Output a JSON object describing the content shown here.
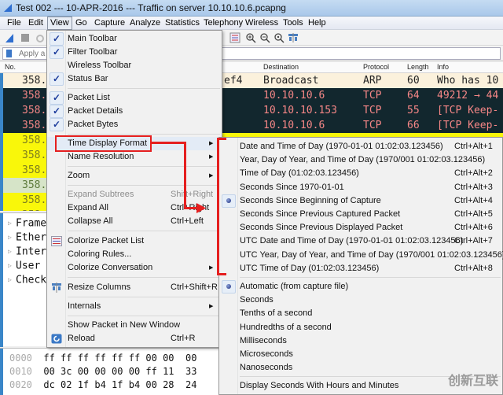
{
  "window": {
    "title": "Test 002 --- 10-APR-2016 --- Traffic on server 10.10.10.6.pcapng"
  },
  "menubar": {
    "items": [
      "File",
      "Edit",
      "View",
      "Go",
      "Capture",
      "Analyze",
      "Statistics",
      "Telephony",
      "Wireless",
      "Tools",
      "Help"
    ],
    "active": "View"
  },
  "toolbar": {
    "icons": [
      "shark-fin-start-icon",
      "stop-icon",
      "restart-icon",
      "colorize-icon",
      "zoom-in-icon",
      "zoom-out-icon",
      "zoom-normal-icon",
      "resize-columns-icon"
    ]
  },
  "filter": {
    "placeholder": "Apply a d"
  },
  "packet_list": {
    "columns": [
      "No.",
      "Destination",
      "Protocol",
      "Length",
      "Info"
    ],
    "rows": [
      {
        "no": "358..",
        "src_tail": "ef4",
        "destination": "Broadcast",
        "protocol": "ARP",
        "length": "60",
        "info": "Who has 10",
        "style": "arp"
      },
      {
        "no": "358..",
        "src_tail": "",
        "destination": "10.10.10.6",
        "protocol": "TCP",
        "length": "64",
        "info": "49212 → 44",
        "style": "dark"
      },
      {
        "no": "358..",
        "src_tail": "",
        "destination": "10.10.10.153",
        "protocol": "TCP",
        "length": "55",
        "info": "[TCP Keep-",
        "style": "dark"
      },
      {
        "no": "358..",
        "src_tail": "",
        "destination": "10.10.10.6",
        "protocol": "TCP",
        "length": "66",
        "info": "[TCP Keep-",
        "style": "dark"
      },
      {
        "no": "358..",
        "style": "yellow"
      },
      {
        "no": "358..",
        "style": "yellow"
      },
      {
        "no": "358..",
        "style": "yellow"
      },
      {
        "no": "358..",
        "style": "sel"
      },
      {
        "no": "358..",
        "style": "yellow"
      },
      {
        "no": "358..",
        "style": "yellow"
      }
    ]
  },
  "packet_details": {
    "rows": [
      "Frame",
      "Ether",
      "Inter",
      "User",
      "Check"
    ]
  },
  "packet_bytes": {
    "rows": [
      {
        "offset": "0000",
        "hex": "ff ff ff ff ff ff 00 00",
        "tail": "00"
      },
      {
        "offset": "0010",
        "hex": "00 3c 00 00 00 00 ff 11",
        "tail": "33"
      },
      {
        "offset": "0020",
        "hex": "dc 02 1f b4 1f b4 00 28",
        "tail": "24"
      }
    ]
  },
  "view_menu": {
    "items": [
      {
        "label": "Main Toolbar",
        "checked": true
      },
      {
        "label": "Filter Toolbar",
        "checked": true
      },
      {
        "label": "Wireless Toolbar",
        "checked": false
      },
      {
        "label": "Status Bar",
        "checked": true
      },
      {
        "label": "Packet List",
        "checked": true
      },
      {
        "label": "Packet Details",
        "checked": true
      },
      {
        "label": "Packet Bytes",
        "checked": true
      },
      {
        "label": "Time Display Format",
        "submenu": true,
        "highlighted": true
      },
      {
        "label": "Name Resolution",
        "submenu": true
      },
      {
        "label": "Zoom",
        "submenu": true
      },
      {
        "label": "Expand Subtrees",
        "shortcut": "Shift+Right",
        "disabled": true
      },
      {
        "label": "Expand All",
        "shortcut": "Ctrl+Right"
      },
      {
        "label": "Collapse All",
        "shortcut": "Ctrl+Left"
      },
      {
        "label": "Colorize Packet List",
        "icon": "colorize-icon"
      },
      {
        "label": "Coloring Rules..."
      },
      {
        "label": "Colorize Conversation",
        "submenu": true
      },
      {
        "label": "Resize Columns",
        "shortcut": "Ctrl+Shift+R",
        "icon": "resize-columns-icon"
      },
      {
        "label": "Internals",
        "submenu": true
      },
      {
        "label": "Show Packet in New Window"
      },
      {
        "label": "Reload",
        "shortcut": "Ctrl+R",
        "icon": "reload-icon"
      }
    ]
  },
  "time_format_menu": {
    "formats": [
      {
        "label": "Date and Time of Day (1970-01-01 01:02:03.123456)",
        "shortcut": "Ctrl+Alt+1"
      },
      {
        "label": "Year, Day of Year, and Time of Day (1970/001 01:02:03.123456)",
        "shortcut": ""
      },
      {
        "label": "Time of Day (01:02:03.123456)",
        "shortcut": "Ctrl+Alt+2"
      },
      {
        "label": "Seconds Since 1970-01-01",
        "shortcut": "Ctrl+Alt+3"
      },
      {
        "label": "Seconds Since Beginning of Capture",
        "shortcut": "Ctrl+Alt+4",
        "selected": true
      },
      {
        "label": "Seconds Since Previous Captured Packet",
        "shortcut": "Ctrl+Alt+5"
      },
      {
        "label": "Seconds Since Previous Displayed Packet",
        "shortcut": "Ctrl+Alt+6"
      },
      {
        "label": "UTC Date and Time of Day (1970-01-01 01:02:03.123456)",
        "shortcut": "Ctrl+Alt+7"
      },
      {
        "label": "UTC Year, Day of Year, and Time of Day (1970/001 01:02:03.123456)",
        "shortcut": ""
      },
      {
        "label": "UTC Time of Day (01:02:03.123456)",
        "shortcut": "Ctrl+Alt+8"
      }
    ],
    "precisions": [
      {
        "label": "Automatic (from capture file)",
        "selected": true
      },
      {
        "label": "Seconds"
      },
      {
        "label": "Tenths of a second"
      },
      {
        "label": "Hundredths of a second"
      },
      {
        "label": "Milliseconds"
      },
      {
        "label": "Microseconds"
      },
      {
        "label": "Nanoseconds"
      }
    ],
    "extra": "Display Seconds With Hours and Minutes"
  },
  "annotation": {
    "color": "#e51f1f"
  },
  "watermark": "创新互联"
}
